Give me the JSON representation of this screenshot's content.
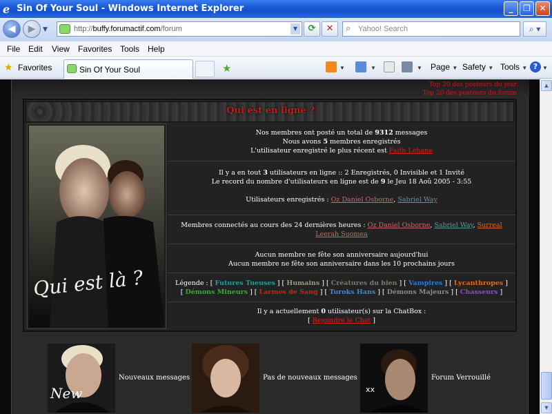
{
  "window": {
    "title": "Sin Of Your Soul - Windows Internet Explorer",
    "minimize": "_",
    "restore": "❐",
    "close": "✕"
  },
  "address": {
    "url_prefix": "http://",
    "url_domain": "buffy.forumactif.com",
    "url_path": "/forum",
    "search_placeholder": "Yahoo! Search"
  },
  "menu": [
    "File",
    "Edit",
    "View",
    "Favorites",
    "Tools",
    "Help"
  ],
  "favorites": {
    "label": "Favorites",
    "tab_label": "Sin Of Your Soul"
  },
  "toolbar": {
    "page": "Page",
    "safety": "Safety",
    "tools": "Tools"
  },
  "forum": {
    "top_links": [
      "Top 20 des posteurs du jour",
      "Top 20 des posteurs du forum"
    ],
    "who_title": "Qui est en ligne ?",
    "image_caption": "Qui est là ?",
    "stats": {
      "line1_pre": "Nos membres ont posté un total de ",
      "line1_num": "9312",
      "line1_post": " messages",
      "line2_pre": "Nous avons ",
      "line2_num": "5",
      "line2_post": " membres enregistrés",
      "line3_pre": "L'utilisateur enregistré le plus récent est ",
      "line3_user": "Faith Lehane"
    },
    "online": {
      "line1_pre": "Il y a en tout ",
      "line1_num": "3",
      "line1_post": " utilisateurs en ligne :: 2 Enregistrés, 0 Invisible et 1 Invité",
      "line2_pre": "Le record du nombre d'utilisateurs en ligne est de ",
      "line2_num": "9",
      "line2_post": " le Jeu 18 Aoû 2005 - 3:55",
      "registered_label": "Utilisateurs enregistrés : ",
      "registered_users": [
        "Oz Daniel Osborne",
        "Sabriel Way"
      ]
    },
    "last24": {
      "label": "Membres connectés au cours des 24 dernières heures : ",
      "users": [
        "Oz Daniel Osborne",
        "Sabriel Way",
        "Surreal",
        "Leerah Suomea"
      ]
    },
    "birthdays": {
      "today": "Aucun membre ne fête son anniversaire aujourd'hui",
      "upcoming": "Aucun membre ne fête son anniversaire dans les 10 prochains jours"
    },
    "legend": {
      "label": "Légende : ",
      "groups": [
        "Futures Tueuses",
        "Humains",
        "Créatures du bien",
        "Vampires",
        "Lycanthropes",
        "Démons Mineurs",
        "Larmes de Sang",
        "Turoks Hans",
        "Démons Majeurs",
        "Chasseurs"
      ]
    },
    "chatbox": {
      "line_pre": "Il y a actuellement ",
      "line_num": "0",
      "line_post": " utilisateur(s) sur la ChatBox :",
      "join": "Rejoindre le Chat"
    },
    "icons_legend": [
      {
        "label": "Nouveaux messages",
        "overlay": "New"
      },
      {
        "label": "Pas de nouveaux messages",
        "overlay": ""
      },
      {
        "label": "Forum Verrouillé",
        "overlay": "xx"
      }
    ]
  },
  "colors": {
    "accent_red": "#d8231c",
    "page_bg": "#0a0a0a",
    "panel_bg": "#222222"
  }
}
